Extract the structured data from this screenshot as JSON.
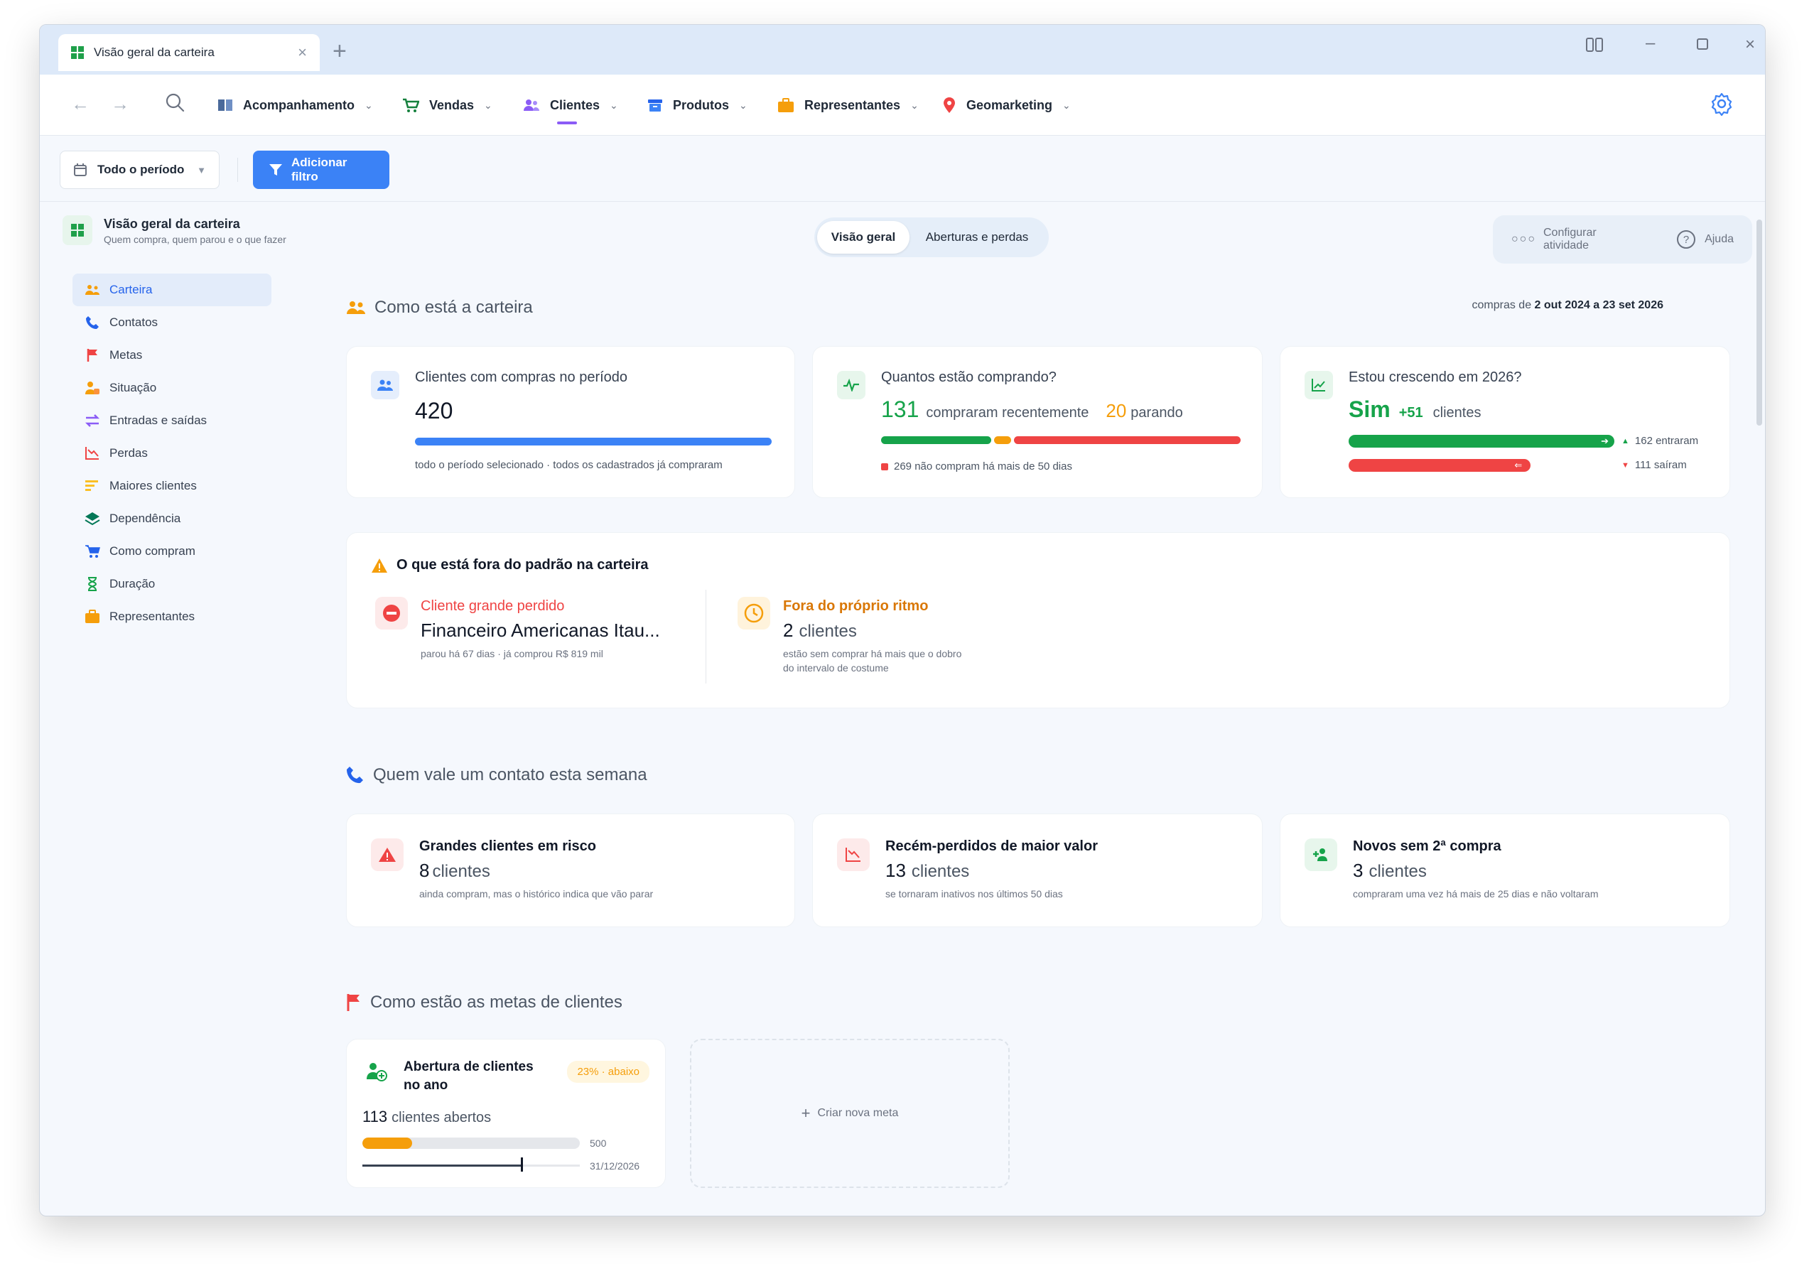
{
  "browser": {
    "tab_title": "Visão geral da carteira"
  },
  "nav": {
    "items": [
      {
        "label": "Acompanhamento"
      },
      {
        "label": "Vendas"
      },
      {
        "label": "Clientes"
      },
      {
        "label": "Produtos"
      },
      {
        "label": "Representantes"
      },
      {
        "label": "Geomarketing"
      }
    ]
  },
  "filters": {
    "period_label": "Todo o período",
    "add_filter_label": "Adicionar filtro"
  },
  "page": {
    "title": "Visão geral da carteira",
    "subtitle": "Quem compra, quem parou e o que fazer",
    "tabs": [
      "Visão geral",
      "Aberturas e perdas"
    ],
    "configure_label": "Configurar atividade",
    "help_label": "Ajuda"
  },
  "sidebar": {
    "items": [
      {
        "label": "Carteira"
      },
      {
        "label": "Contatos"
      },
      {
        "label": "Metas"
      },
      {
        "label": "Situação"
      },
      {
        "label": "Entradas e saídas"
      },
      {
        "label": "Perdas"
      },
      {
        "label": "Maiores clientes"
      },
      {
        "label": "Dependência"
      },
      {
        "label": "Como compram"
      },
      {
        "label": "Duração"
      },
      {
        "label": "Representantes"
      }
    ]
  },
  "section1": {
    "title": "Como está a carteira",
    "date_prefix": "compras de",
    "date_range": "2 out 2024 a 23 set 2026",
    "card1": {
      "label": "Clientes com compras no período",
      "value": "420",
      "note": "todo o período selecionado · todos os cadastrados já compraram",
      "progress": 1.0
    },
    "card2": {
      "label": "Quantos estão comprando?",
      "buying_value": "131",
      "buying_text": "compraram recentemente",
      "stopping_value": "20",
      "stopping_text": "parando",
      "note": "269 não compram há mais de 50 dias",
      "segments": [
        131,
        20,
        269
      ]
    },
    "card3": {
      "label": "Estou crescendo em 2026?",
      "answer": "Sim",
      "delta": "+51",
      "delta_text": "clientes",
      "in_text": "162 entraram",
      "out_text": "111 saíram",
      "in_value": 162,
      "out_value": 111
    }
  },
  "outliers": {
    "title": "O que está fora do padrão na carteira",
    "item1": {
      "kind": "Cliente grande perdido",
      "name": "Financeiro Americanas Itau...",
      "note": "parou há 67 dias · já comprou R$ 819 mil"
    },
    "item2": {
      "kind": "Fora do próprio ritmo",
      "value": "2",
      "unit": "clientes",
      "note_line1": "estão sem comprar há mais que o dobro",
      "note_line2": "do intervalo de costume"
    }
  },
  "section2": {
    "title": "Quem vale um contato esta semana",
    "cards": [
      {
        "title": "Grandes clientes em risco",
        "value": "8",
        "unit": "clientes",
        "note": "ainda compram, mas o histórico indica que vão parar"
      },
      {
        "title": "Recém-perdidos de maior valor",
        "value": "13",
        "unit": "clientes",
        "note": "se tornaram inativos nos últimos 50 dias"
      },
      {
        "title": "Novos sem 2ª compra",
        "value": "3",
        "unit": "clientes",
        "note": "compraram uma vez há mais de 25 dias e não voltaram"
      }
    ]
  },
  "section3": {
    "title": "Como estão as metas de clientes",
    "goal": {
      "title_line1": "Abertura de clientes",
      "title_line2": "no ano",
      "badge": "23% · abaixo",
      "value": "113",
      "unit": "clientes abertos",
      "target": "500",
      "deadline": "31/12/2026",
      "progress": 0.23,
      "time_progress": 0.73
    },
    "new_goal_label": "Criar nova meta"
  },
  "colors": {
    "accent": "#3b82f6",
    "green": "#16a34a",
    "orange": "#f59e0b",
    "red": "#ef4444",
    "purple": "#8b5cf6"
  }
}
